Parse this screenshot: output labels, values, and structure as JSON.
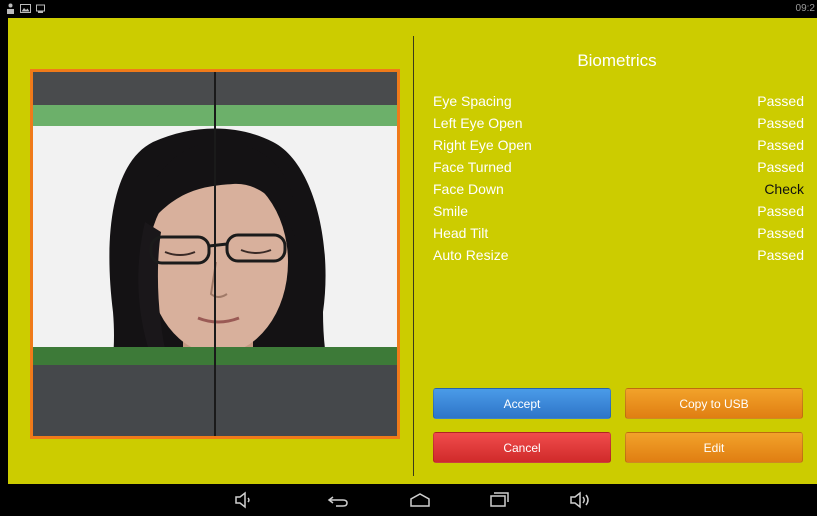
{
  "status_bar": {
    "icons": [
      "person-icon",
      "photo-icon",
      "device-icon"
    ],
    "time": "09:2"
  },
  "biometrics": {
    "title": "Biometrics",
    "items": [
      {
        "label": "Eye Spacing",
        "status": "Passed"
      },
      {
        "label": "Left Eye Open",
        "status": "Passed"
      },
      {
        "label": "Right Eye Open",
        "status": "Passed"
      },
      {
        "label": "Face Turned",
        "status": "Passed"
      },
      {
        "label": "Face Down",
        "status": "Check"
      },
      {
        "label": "Smile",
        "status": "Passed"
      },
      {
        "label": "Head Tilt",
        "status": "Passed"
      },
      {
        "label": "Auto Resize",
        "status": "Passed"
      }
    ]
  },
  "buttons": {
    "accept": "Accept",
    "copy_usb": "Copy to USB",
    "cancel": "Cancel",
    "edit": "Edit"
  },
  "nav_bar": {
    "icons": [
      "volume-down-icon",
      "back-icon",
      "home-icon",
      "recents-icon",
      "volume-up-icon"
    ]
  },
  "colors": {
    "background": "#cccc00",
    "frame_border": "#f07a1a",
    "accept": "#3a88dc",
    "copy_usb": "#ea9020",
    "cancel": "#e03a3a",
    "edit": "#ea9020",
    "passed_text": "#ffffff",
    "check_text": "#111111"
  }
}
